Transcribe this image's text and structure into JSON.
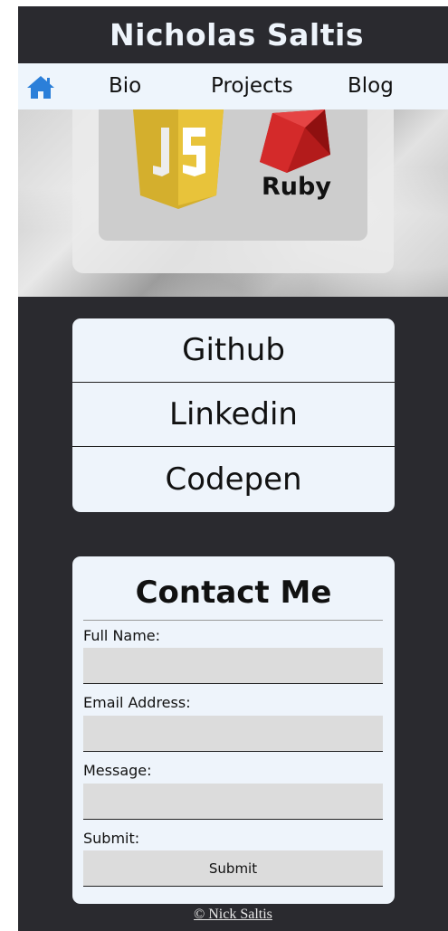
{
  "header": {
    "title": "Nicholas Saltis"
  },
  "nav": {
    "home_icon": "home-icon",
    "items": [
      {
        "label": "Bio"
      },
      {
        "label": "Projects"
      },
      {
        "label": "Blog"
      }
    ],
    "accent_color": "#2b7fd9"
  },
  "hero": {
    "logos": [
      {
        "icon": "javascript-logo",
        "label": ""
      },
      {
        "icon": "ruby-logo",
        "label": "Ruby"
      }
    ]
  },
  "links": [
    {
      "label": "Github"
    },
    {
      "label": "Linkedin"
    },
    {
      "label": "Codepen"
    }
  ],
  "contact": {
    "title": "Contact Me",
    "fields": [
      {
        "label": "Full Name:",
        "value": ""
      },
      {
        "label": "Email Address:",
        "value": ""
      },
      {
        "label": "Message:",
        "value": ""
      }
    ],
    "submit_label": "Submit:",
    "submit_button": "Submit"
  },
  "footer": {
    "text": "© Nick Saltis"
  },
  "colors": {
    "page_bg": "#2a2a2f",
    "card_bg": "#eef4fb",
    "input_bg": "#dcdcdc"
  }
}
